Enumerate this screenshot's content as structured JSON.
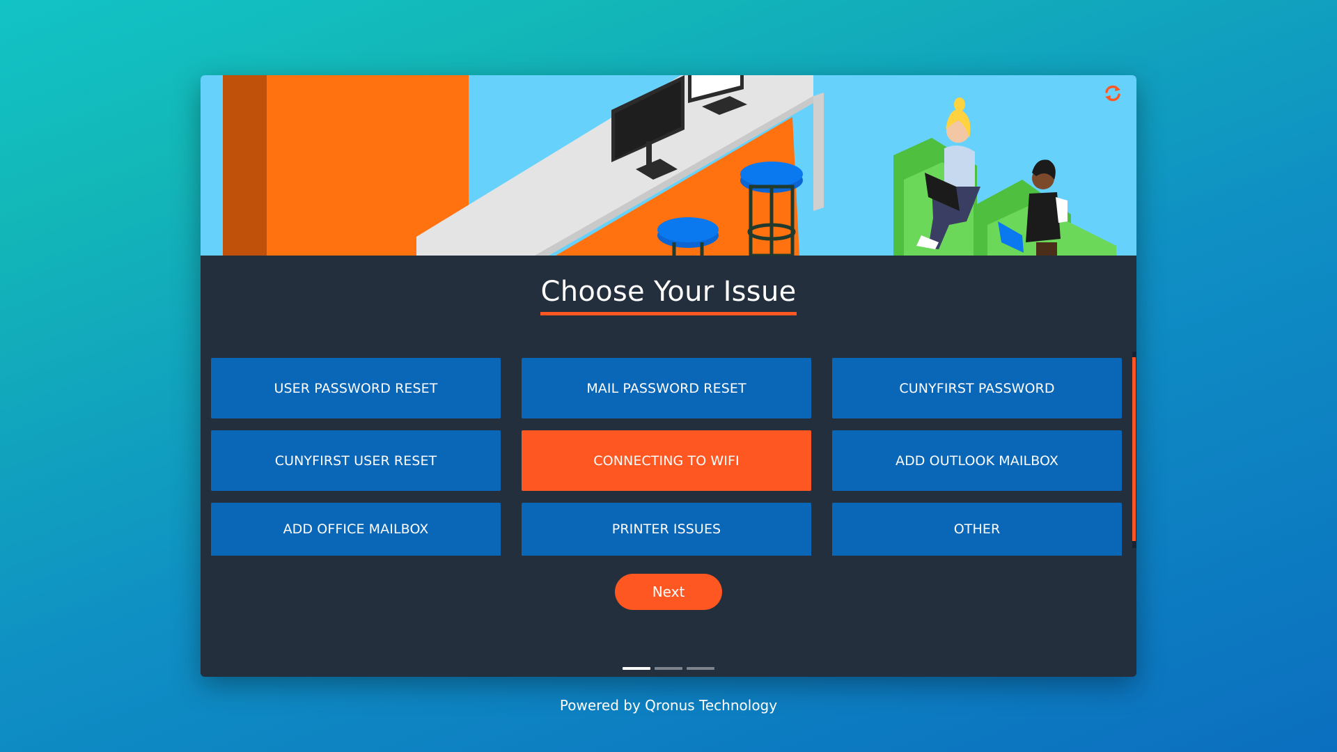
{
  "header": {
    "refresh_icon": "refresh-icon",
    "illustration": "help-desk-office-illustration"
  },
  "main": {
    "title": "Choose Your Issue",
    "issues": [
      {
        "label": "USER PASSWORD RESET",
        "selected": false
      },
      {
        "label": "MAIL PASSWORD RESET",
        "selected": false
      },
      {
        "label": "CUNYFIRST PASSWORD",
        "selected": false
      },
      {
        "label": "CUNYFIRST USER RESET",
        "selected": false
      },
      {
        "label": "CONNECTING TO WIFI",
        "selected": true
      },
      {
        "label": "ADD OUTLOOK MAILBOX",
        "selected": false
      },
      {
        "label": "ADD OFFICE MAILBOX",
        "selected": false
      },
      {
        "label": "PRINTER ISSUES",
        "selected": false
      },
      {
        "label": "OTHER",
        "selected": false
      }
    ],
    "next_label": "Next",
    "steps": {
      "total": 3,
      "current": 1
    }
  },
  "footer": {
    "text": "Powered by Qronus Technology"
  },
  "colors": {
    "accent": "#ff5722",
    "button": "#0a66b7",
    "panel": "#242f3d",
    "hero_sky": "#66d2fc"
  }
}
